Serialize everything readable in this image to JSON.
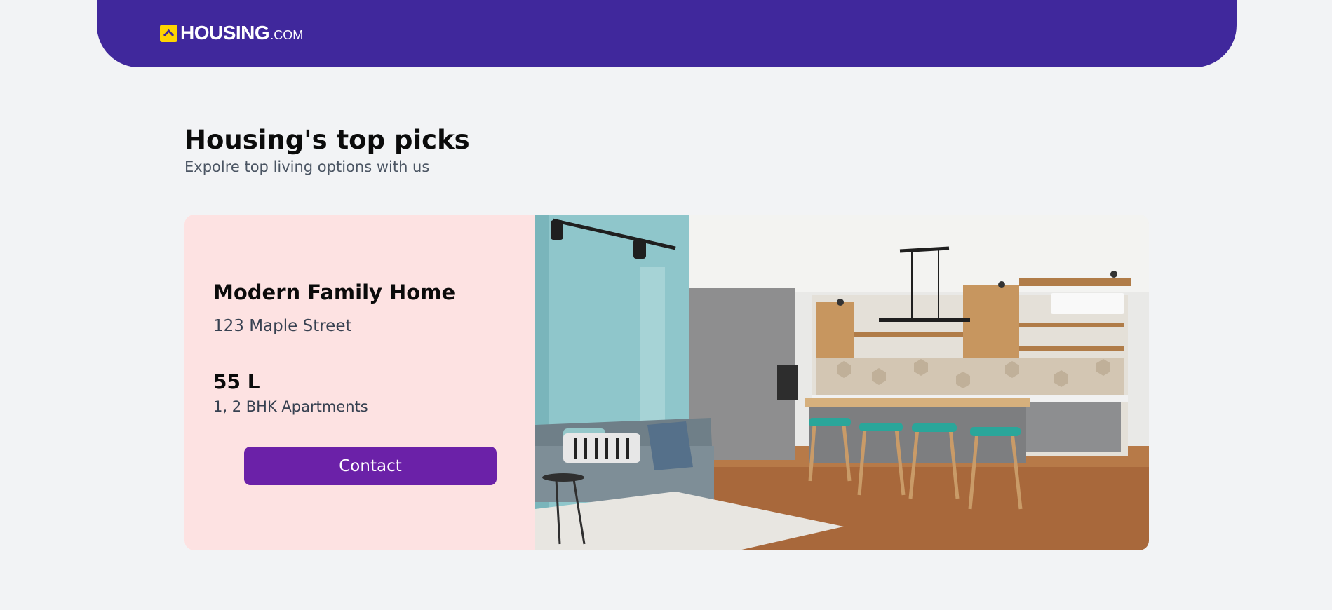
{
  "header": {
    "logo_word": "HOUSING",
    "logo_suffix": ".COM",
    "brand_color": "#40289c",
    "logo_accent": "#ffd400"
  },
  "section": {
    "title": "Housing's top picks",
    "subtitle": "Expolre top living options with us"
  },
  "listing": {
    "name": "Modern Family Home",
    "address": "123 Maple Street",
    "price": "55 L",
    "configuration": "1, 2 BHK Apartments",
    "contact_label": "Contact",
    "button_color": "#6b21a8",
    "card_color": "#fde2e2",
    "photo": "living-room-kitchen-photo"
  }
}
